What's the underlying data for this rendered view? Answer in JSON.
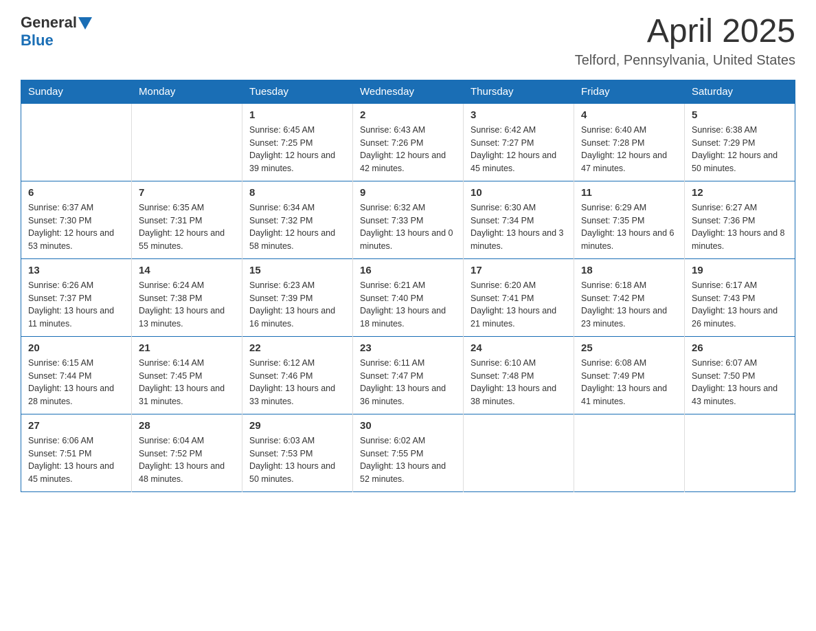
{
  "header": {
    "logo_general": "General",
    "logo_blue": "Blue",
    "month": "April 2025",
    "location": "Telford, Pennsylvania, United States"
  },
  "weekdays": [
    "Sunday",
    "Monday",
    "Tuesday",
    "Wednesday",
    "Thursday",
    "Friday",
    "Saturday"
  ],
  "weeks": [
    [
      {
        "day": "",
        "sunrise": "",
        "sunset": "",
        "daylight": ""
      },
      {
        "day": "",
        "sunrise": "",
        "sunset": "",
        "daylight": ""
      },
      {
        "day": "1",
        "sunrise": "Sunrise: 6:45 AM",
        "sunset": "Sunset: 7:25 PM",
        "daylight": "Daylight: 12 hours and 39 minutes."
      },
      {
        "day": "2",
        "sunrise": "Sunrise: 6:43 AM",
        "sunset": "Sunset: 7:26 PM",
        "daylight": "Daylight: 12 hours and 42 minutes."
      },
      {
        "day": "3",
        "sunrise": "Sunrise: 6:42 AM",
        "sunset": "Sunset: 7:27 PM",
        "daylight": "Daylight: 12 hours and 45 minutes."
      },
      {
        "day": "4",
        "sunrise": "Sunrise: 6:40 AM",
        "sunset": "Sunset: 7:28 PM",
        "daylight": "Daylight: 12 hours and 47 minutes."
      },
      {
        "day": "5",
        "sunrise": "Sunrise: 6:38 AM",
        "sunset": "Sunset: 7:29 PM",
        "daylight": "Daylight: 12 hours and 50 minutes."
      }
    ],
    [
      {
        "day": "6",
        "sunrise": "Sunrise: 6:37 AM",
        "sunset": "Sunset: 7:30 PM",
        "daylight": "Daylight: 12 hours and 53 minutes."
      },
      {
        "day": "7",
        "sunrise": "Sunrise: 6:35 AM",
        "sunset": "Sunset: 7:31 PM",
        "daylight": "Daylight: 12 hours and 55 minutes."
      },
      {
        "day": "8",
        "sunrise": "Sunrise: 6:34 AM",
        "sunset": "Sunset: 7:32 PM",
        "daylight": "Daylight: 12 hours and 58 minutes."
      },
      {
        "day": "9",
        "sunrise": "Sunrise: 6:32 AM",
        "sunset": "Sunset: 7:33 PM",
        "daylight": "Daylight: 13 hours and 0 minutes."
      },
      {
        "day": "10",
        "sunrise": "Sunrise: 6:30 AM",
        "sunset": "Sunset: 7:34 PM",
        "daylight": "Daylight: 13 hours and 3 minutes."
      },
      {
        "day": "11",
        "sunrise": "Sunrise: 6:29 AM",
        "sunset": "Sunset: 7:35 PM",
        "daylight": "Daylight: 13 hours and 6 minutes."
      },
      {
        "day": "12",
        "sunrise": "Sunrise: 6:27 AM",
        "sunset": "Sunset: 7:36 PM",
        "daylight": "Daylight: 13 hours and 8 minutes."
      }
    ],
    [
      {
        "day": "13",
        "sunrise": "Sunrise: 6:26 AM",
        "sunset": "Sunset: 7:37 PM",
        "daylight": "Daylight: 13 hours and 11 minutes."
      },
      {
        "day": "14",
        "sunrise": "Sunrise: 6:24 AM",
        "sunset": "Sunset: 7:38 PM",
        "daylight": "Daylight: 13 hours and 13 minutes."
      },
      {
        "day": "15",
        "sunrise": "Sunrise: 6:23 AM",
        "sunset": "Sunset: 7:39 PM",
        "daylight": "Daylight: 13 hours and 16 minutes."
      },
      {
        "day": "16",
        "sunrise": "Sunrise: 6:21 AM",
        "sunset": "Sunset: 7:40 PM",
        "daylight": "Daylight: 13 hours and 18 minutes."
      },
      {
        "day": "17",
        "sunrise": "Sunrise: 6:20 AM",
        "sunset": "Sunset: 7:41 PM",
        "daylight": "Daylight: 13 hours and 21 minutes."
      },
      {
        "day": "18",
        "sunrise": "Sunrise: 6:18 AM",
        "sunset": "Sunset: 7:42 PM",
        "daylight": "Daylight: 13 hours and 23 minutes."
      },
      {
        "day": "19",
        "sunrise": "Sunrise: 6:17 AM",
        "sunset": "Sunset: 7:43 PM",
        "daylight": "Daylight: 13 hours and 26 minutes."
      }
    ],
    [
      {
        "day": "20",
        "sunrise": "Sunrise: 6:15 AM",
        "sunset": "Sunset: 7:44 PM",
        "daylight": "Daylight: 13 hours and 28 minutes."
      },
      {
        "day": "21",
        "sunrise": "Sunrise: 6:14 AM",
        "sunset": "Sunset: 7:45 PM",
        "daylight": "Daylight: 13 hours and 31 minutes."
      },
      {
        "day": "22",
        "sunrise": "Sunrise: 6:12 AM",
        "sunset": "Sunset: 7:46 PM",
        "daylight": "Daylight: 13 hours and 33 minutes."
      },
      {
        "day": "23",
        "sunrise": "Sunrise: 6:11 AM",
        "sunset": "Sunset: 7:47 PM",
        "daylight": "Daylight: 13 hours and 36 minutes."
      },
      {
        "day": "24",
        "sunrise": "Sunrise: 6:10 AM",
        "sunset": "Sunset: 7:48 PM",
        "daylight": "Daylight: 13 hours and 38 minutes."
      },
      {
        "day": "25",
        "sunrise": "Sunrise: 6:08 AM",
        "sunset": "Sunset: 7:49 PM",
        "daylight": "Daylight: 13 hours and 41 minutes."
      },
      {
        "day": "26",
        "sunrise": "Sunrise: 6:07 AM",
        "sunset": "Sunset: 7:50 PM",
        "daylight": "Daylight: 13 hours and 43 minutes."
      }
    ],
    [
      {
        "day": "27",
        "sunrise": "Sunrise: 6:06 AM",
        "sunset": "Sunset: 7:51 PM",
        "daylight": "Daylight: 13 hours and 45 minutes."
      },
      {
        "day": "28",
        "sunrise": "Sunrise: 6:04 AM",
        "sunset": "Sunset: 7:52 PM",
        "daylight": "Daylight: 13 hours and 48 minutes."
      },
      {
        "day": "29",
        "sunrise": "Sunrise: 6:03 AM",
        "sunset": "Sunset: 7:53 PM",
        "daylight": "Daylight: 13 hours and 50 minutes."
      },
      {
        "day": "30",
        "sunrise": "Sunrise: 6:02 AM",
        "sunset": "Sunset: 7:55 PM",
        "daylight": "Daylight: 13 hours and 52 minutes."
      },
      {
        "day": "",
        "sunrise": "",
        "sunset": "",
        "daylight": ""
      },
      {
        "day": "",
        "sunrise": "",
        "sunset": "",
        "daylight": ""
      },
      {
        "day": "",
        "sunrise": "",
        "sunset": "",
        "daylight": ""
      }
    ]
  ]
}
